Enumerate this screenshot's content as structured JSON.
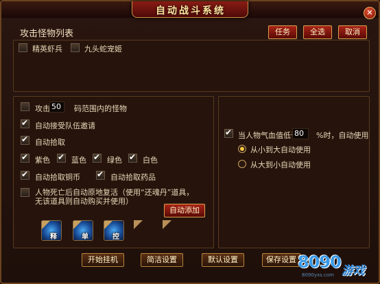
{
  "window": {
    "title": "自动战斗系统",
    "close_glyph": "✕"
  },
  "monster_list": {
    "title": "攻击怪物列表",
    "buttons": {
      "task": "任务",
      "select_all": "全选",
      "cancel": "取消"
    },
    "items": [
      {
        "label": "精英虾兵",
        "checked": false
      },
      {
        "label": "九头蛇宠姬",
        "checked": false
      }
    ]
  },
  "left_options": {
    "attack_prefix": "攻击",
    "attack_range": "50",
    "attack_suffix": "码范围内的怪物",
    "attack_checked": false,
    "auto_team_invite": {
      "label": "自动接受队伍邀请",
      "checked": true
    },
    "auto_pickup": {
      "label": "自动拾取",
      "checked": true
    },
    "colors": [
      {
        "label": "紫色",
        "checked": true
      },
      {
        "label": "蓝色",
        "checked": true
      },
      {
        "label": "绿色",
        "checked": true
      },
      {
        "label": "白色",
        "checked": true
      }
    ],
    "auto_copper": {
      "label": "自动拾取铜币",
      "checked": true
    },
    "auto_potion": {
      "label": "自动拾取药品",
      "checked": true
    },
    "revive": {
      "label_line1": "人物死亡后自动原地复活（使用“还魂丹”道具，",
      "label_line2": "无该道具则自动购买并使用）",
      "checked": false
    },
    "auto_add_button": "自动添加",
    "skills": [
      {
        "name": "skill-slot-release",
        "label": "释"
      },
      {
        "name": "skill-slot-single",
        "label": "单"
      },
      {
        "name": "skill-slot-control",
        "label": "控"
      }
    ]
  },
  "right_options": {
    "hp_prefix": "当人物气血值低于",
    "hp_value": "80",
    "hp_suffix": "%时，自动使用药",
    "hp_checked": true,
    "order_options": [
      {
        "label": "从小到大自动使用",
        "selected": true
      },
      {
        "label": "从大到小自动使用",
        "selected": false
      }
    ]
  },
  "footer": {
    "start": "开始挂机",
    "simple": "简洁设置",
    "default": "默认设置",
    "save": "保存设置"
  },
  "logo": {
    "numbers": "8090",
    "text": "游戏",
    "url": "8090yxs.com"
  },
  "colors": {
    "accent_red": "#a82416",
    "gold_border": "#d8a050",
    "panel_bg": "#26140c"
  }
}
